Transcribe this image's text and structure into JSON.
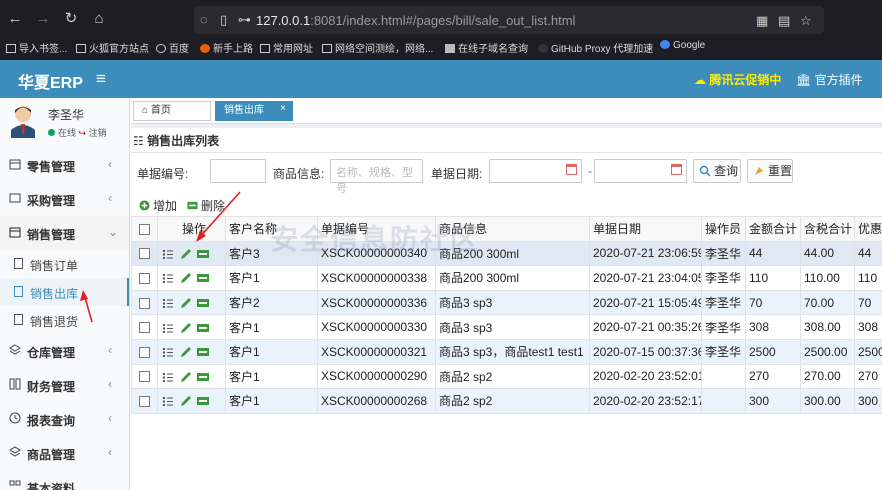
{
  "browser": {
    "url_host": "127.0.0.1",
    "url_rest": ":8081/index.html#/pages/bill/sale_out_list.html",
    "bookmarks": [
      "导入书签...",
      "火狐官方站点",
      "百度",
      "新手上路",
      "常用网址",
      "网络空间测绘，网络...",
      "在线子域名查询",
      "GitHub Proxy 代理加速",
      "Google"
    ]
  },
  "header": {
    "logo": "华夏ERP",
    "promo": "腾讯云促销中",
    "plugin": "官方插件"
  },
  "user": {
    "name": "李圣华",
    "status": "在线",
    "logout": "注销"
  },
  "sidebar": {
    "items": [
      {
        "label": "零售管理"
      },
      {
        "label": "采购管理"
      },
      {
        "label": "销售管理"
      },
      {
        "label": "仓库管理"
      },
      {
        "label": "财务管理"
      },
      {
        "label": "报表查询"
      },
      {
        "label": "商品管理"
      },
      {
        "label": "基本资料"
      }
    ],
    "subitems": [
      {
        "label": "销售订单"
      },
      {
        "label": "销售出库"
      },
      {
        "label": "销售退货"
      }
    ]
  },
  "tabs": [
    {
      "label": "首页"
    },
    {
      "label": "销售出库"
    }
  ],
  "panel": {
    "title": "销售出库列表"
  },
  "filters": {
    "bill_no_label": "单据编号:",
    "goods_label": "商品信息:",
    "goods_placeholder": "名称、规格、型号",
    "date_label": "单据日期:",
    "date_sep": "-"
  },
  "actions": {
    "search": "查询",
    "reset": "重置",
    "add": "增加",
    "delete": "删除"
  },
  "table": {
    "headers": [
      "操作",
      "客户名称",
      "单据编号",
      "商品信息",
      "单据日期",
      "操作员",
      "金额合计",
      "含税合计",
      "优惠"
    ],
    "rows": [
      {
        "customer": "客户3",
        "bill": "XSCK00000000340",
        "goods": "商品200 300ml",
        "date": "2020-07-21 23:06:59",
        "op": "李圣华",
        "amount": "44",
        "tax": "44.00",
        "disc": "44"
      },
      {
        "customer": "客户1",
        "bill": "XSCK00000000338",
        "goods": "商品200 300ml",
        "date": "2020-07-21 23:04:05",
        "op": "李圣华",
        "amount": "110",
        "tax": "110.00",
        "disc": "110"
      },
      {
        "customer": "客户2",
        "bill": "XSCK00000000336",
        "goods": "商品3 sp3",
        "date": "2020-07-21 15:05:49",
        "op": "李圣华",
        "amount": "70",
        "tax": "70.00",
        "disc": "70"
      },
      {
        "customer": "客户1",
        "bill": "XSCK00000000330",
        "goods": "商品3 sp3",
        "date": "2020-07-21 00:35:26",
        "op": "李圣华",
        "amount": "308",
        "tax": "308.00",
        "disc": "308"
      },
      {
        "customer": "客户1",
        "bill": "XSCK00000000321",
        "goods": "商品3 sp3，商品test1 test1",
        "date": "2020-07-15 00:37:36",
        "op": "李圣华",
        "amount": "2500",
        "tax": "2500.00",
        "disc": "2500"
      },
      {
        "customer": "客户1",
        "bill": "XSCK00000000290",
        "goods": "商品2 sp2",
        "date": "2020-02-20 23:52:01",
        "op": "",
        "amount": "270",
        "tax": "270.00",
        "disc": "270"
      },
      {
        "customer": "客户1",
        "bill": "XSCK00000000268",
        "goods": "商品2 sp2",
        "date": "2020-02-20 23:52:17",
        "op": "",
        "amount": "300",
        "tax": "300.00",
        "disc": "300"
      }
    ]
  },
  "watermark": "安全信息防社区",
  "colors": {
    "header": "#3c8dbc",
    "browser": "#1e1d23",
    "arrow": "#e02020",
    "edit": "#3a9a3a"
  }
}
